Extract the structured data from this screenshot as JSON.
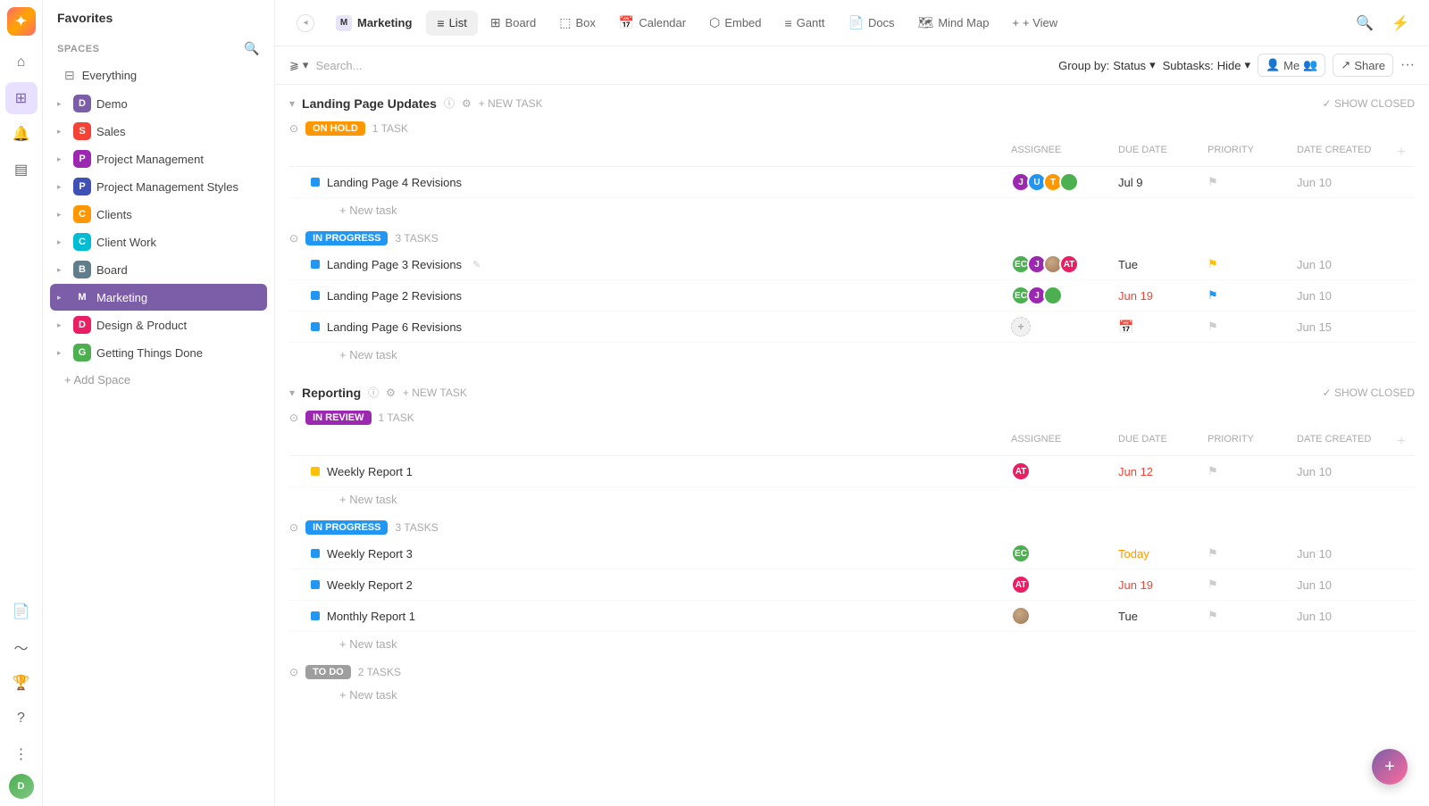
{
  "app": {
    "logo": "✦",
    "favorites_label": "Favorites",
    "spaces_label": "Spaces"
  },
  "sidebar": {
    "everything_label": "Everything",
    "items": [
      {
        "id": "demo",
        "label": "Demo",
        "color": "#9c27b0",
        "letter": "D",
        "bg": "#7b5ea7"
      },
      {
        "id": "sales",
        "label": "Sales",
        "color": "#f44336",
        "letter": "S",
        "bg": "#f44336"
      },
      {
        "id": "project-management",
        "label": "Project Management",
        "color": "#9c27b0",
        "letter": "P",
        "bg": "#9c27b0"
      },
      {
        "id": "project-management-styles",
        "label": "Project Management Styles",
        "color": "#3f51b5",
        "letter": "P",
        "bg": "#3f51b5"
      },
      {
        "id": "clients",
        "label": "Clients",
        "color": "#ff9800",
        "letter": "C",
        "bg": "#ff9800"
      },
      {
        "id": "client-work",
        "label": "Client Work",
        "color": "#00bcd4",
        "letter": "C",
        "bg": "#00bcd4"
      },
      {
        "id": "board",
        "label": "Board",
        "color": "#607d8b",
        "letter": "B",
        "bg": "#607d8b"
      },
      {
        "id": "marketing",
        "label": "Marketing",
        "color": "#7b5ea7",
        "letter": "M",
        "bg": "#7b5ea7",
        "active": true
      },
      {
        "id": "design-product",
        "label": "Design & Product",
        "color": "#e91e63",
        "letter": "D",
        "bg": "#e91e63"
      },
      {
        "id": "getting-things-done",
        "label": "Getting Things Done",
        "color": "#4caf50",
        "letter": "G",
        "bg": "#4caf50"
      }
    ],
    "add_space_label": "+ Add Space"
  },
  "tabs": [
    {
      "id": "marketing",
      "label": "Marketing",
      "active": false,
      "isTitle": true
    },
    {
      "id": "list",
      "label": "List",
      "icon": "≡",
      "active": true
    },
    {
      "id": "board",
      "label": "Board",
      "icon": "⊞",
      "active": false
    },
    {
      "id": "box",
      "label": "Box",
      "icon": "⬚",
      "active": false
    },
    {
      "id": "calendar",
      "label": "Calendar",
      "icon": "📅",
      "active": false
    },
    {
      "id": "embed",
      "label": "Embed",
      "icon": "⬡",
      "active": false
    },
    {
      "id": "gantt",
      "label": "Gantt",
      "icon": "≡",
      "active": false
    },
    {
      "id": "docs",
      "label": "Docs",
      "icon": "📄",
      "active": false
    },
    {
      "id": "mind-map",
      "label": "Mind Map",
      "icon": "🗺",
      "active": false
    }
  ],
  "add_view_label": "+ View",
  "toolbar": {
    "search_placeholder": "Search...",
    "group_by_label": "Group by:",
    "group_by_value": "Status",
    "subtasks_label": "Subtasks:",
    "subtasks_value": "Hide",
    "me_label": "Me",
    "share_label": "Share"
  },
  "sections": [
    {
      "id": "landing-page-updates",
      "title": "Landing Page Updates",
      "show_closed_label": "SHOW CLOSED",
      "new_task_label": "+ NEW TASK",
      "groups": [
        {
          "status": "ON HOLD",
          "status_class": "status-on-hold",
          "task_count": "1 TASK",
          "columns": [
            "ASSIGNEE",
            "DUE DATE",
            "PRIORITY",
            "DATE CREATED"
          ],
          "tasks": [
            {
              "name": "Landing Page 4 Revisions",
              "dot_class": "dot-blue",
              "assignees": [
                {
                  "initials": "J",
                  "class": "av-purple"
                },
                {
                  "initials": "U",
                  "class": "av-blue"
                },
                {
                  "initials": "T",
                  "class": "av-orange"
                },
                {
                  "initials": "",
                  "class": "av-badge av-green"
                }
              ],
              "due_date": "Jul 9",
              "due_date_class": "",
              "priority_class": "flag-gray",
              "date_created": "Jun 10"
            }
          ],
          "new_task_label": "+ New task"
        },
        {
          "status": "IN PROGRESS",
          "status_class": "status-in-progress",
          "task_count": "3 TASKS",
          "columns": [],
          "tasks": [
            {
              "name": "Landing Page 3 Revisions",
              "dot_class": "dot-blue",
              "has_edit": true,
              "assignees": [
                {
                  "initials": "EC",
                  "class": "av-green"
                },
                {
                  "initials": "J",
                  "class": "av-purple"
                },
                {
                  "initials": "",
                  "class": "av-photo"
                },
                {
                  "initials": "AT",
                  "class": "av-pink"
                }
              ],
              "due_date": "Tue",
              "due_date_class": "",
              "priority_class": "flag-yellow",
              "date_created": "Jun 10"
            },
            {
              "name": "Landing Page 2 Revisions",
              "dot_class": "dot-blue",
              "assignees": [
                {
                  "initials": "EC",
                  "class": "av-green"
                },
                {
                  "initials": "J",
                  "class": "av-purple"
                },
                {
                  "initials": "",
                  "class": "av-badge av-blue"
                }
              ],
              "due_date": "Jun 19",
              "due_date_class": "overdue",
              "priority_class": "flag-blue",
              "date_created": "Jun 10"
            },
            {
              "name": "Landing Page 6 Revisions",
              "dot_class": "dot-blue",
              "assignees": [],
              "due_date": "",
              "due_date_class": "",
              "priority_class": "flag-gray",
              "date_created": "Jun 15"
            }
          ],
          "new_task_label": "+ New task"
        }
      ]
    },
    {
      "id": "reporting",
      "title": "Reporting",
      "show_closed_label": "SHOW CLOSED",
      "new_task_label": "+ NEW TASK",
      "groups": [
        {
          "status": "IN REVIEW",
          "status_class": "status-in-review",
          "task_count": "1 TASK",
          "columns": [
            "ASSIGNEE",
            "DUE DATE",
            "PRIORITY",
            "DATE CREATED"
          ],
          "tasks": [
            {
              "name": "Weekly Report 1",
              "dot_class": "dot-yellow",
              "assignees": [
                {
                  "initials": "AT",
                  "class": "av-pink"
                }
              ],
              "due_date": "Jun 12",
              "due_date_class": "overdue",
              "priority_class": "flag-gray",
              "date_created": "Jun 10"
            }
          ],
          "new_task_label": "+ New task"
        },
        {
          "status": "IN PROGRESS",
          "status_class": "status-in-progress",
          "task_count": "3 TASKS",
          "columns": [],
          "tasks": [
            {
              "name": "Weekly Report 3",
              "dot_class": "dot-blue",
              "assignees": [
                {
                  "initials": "EC",
                  "class": "av-green"
                }
              ],
              "due_date": "Today",
              "due_date_class": "today",
              "priority_class": "flag-gray",
              "date_created": "Jun 10"
            },
            {
              "name": "Weekly Report 2",
              "dot_class": "dot-blue",
              "assignees": [
                {
                  "initials": "AT",
                  "class": "av-pink"
                }
              ],
              "due_date": "Jun 19",
              "due_date_class": "overdue",
              "priority_class": "flag-gray",
              "date_created": "Jun 10"
            },
            {
              "name": "Monthly Report 1",
              "dot_class": "dot-blue",
              "assignees": [
                {
                  "initials": "",
                  "class": "av-photo"
                }
              ],
              "due_date": "Tue",
              "due_date_class": "",
              "priority_class": "flag-gray",
              "date_created": "Jun 10"
            }
          ],
          "new_task_label": "+ New task"
        },
        {
          "status": "TO DO",
          "status_class": "status-to-do",
          "task_count": "2 TASKS",
          "columns": [],
          "tasks": [],
          "new_task_label": "+ New task"
        }
      ]
    }
  ],
  "fab_label": "+",
  "icons": {
    "search": "🔍",
    "bell": "🔔",
    "lightning": "⚡",
    "trophy": "🏆",
    "question": "?",
    "dots": "⋮",
    "filter": "⫺",
    "chevron_down": "▾",
    "chevron_right": "▸",
    "collapse": "◂",
    "check": "✓",
    "plus": "+",
    "info": "ⓘ",
    "gear": "⚙",
    "person": "👤"
  }
}
